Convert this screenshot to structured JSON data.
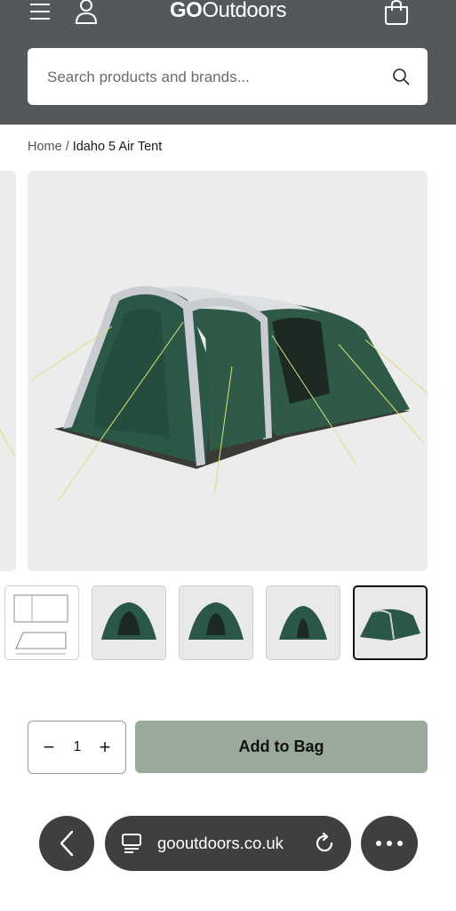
{
  "header": {
    "logo_go": "GO",
    "logo_rest": "Outdoors",
    "icons": {
      "menu": "hamburger-icon",
      "account": "user-icon",
      "bag": "shopping-bag-icon"
    },
    "background": "#55585b"
  },
  "search": {
    "placeholder": "Search products and brands...",
    "value": "",
    "icon": "search-icon"
  },
  "breadcrumb": {
    "home": "Home",
    "separator": "/",
    "current": "Idaho 5 Air Tent"
  },
  "gallery": {
    "thumbnails": [
      {
        "type": "floor-plan"
      },
      {
        "type": "tent-front"
      },
      {
        "type": "tent-front"
      },
      {
        "type": "tent-front"
      },
      {
        "type": "tent-angle",
        "selected": true
      }
    ]
  },
  "purchase": {
    "quantity": "1",
    "minus": "−",
    "plus": "+",
    "add_label": "Add to Bag",
    "button_color": "#9aaa9a"
  },
  "browser": {
    "url": "gooutdoors.co.uk",
    "icons": {
      "back": "chevron-left-icon",
      "tabs": "tabs-icon",
      "reload": "reload-icon",
      "more": "more-icon"
    }
  }
}
